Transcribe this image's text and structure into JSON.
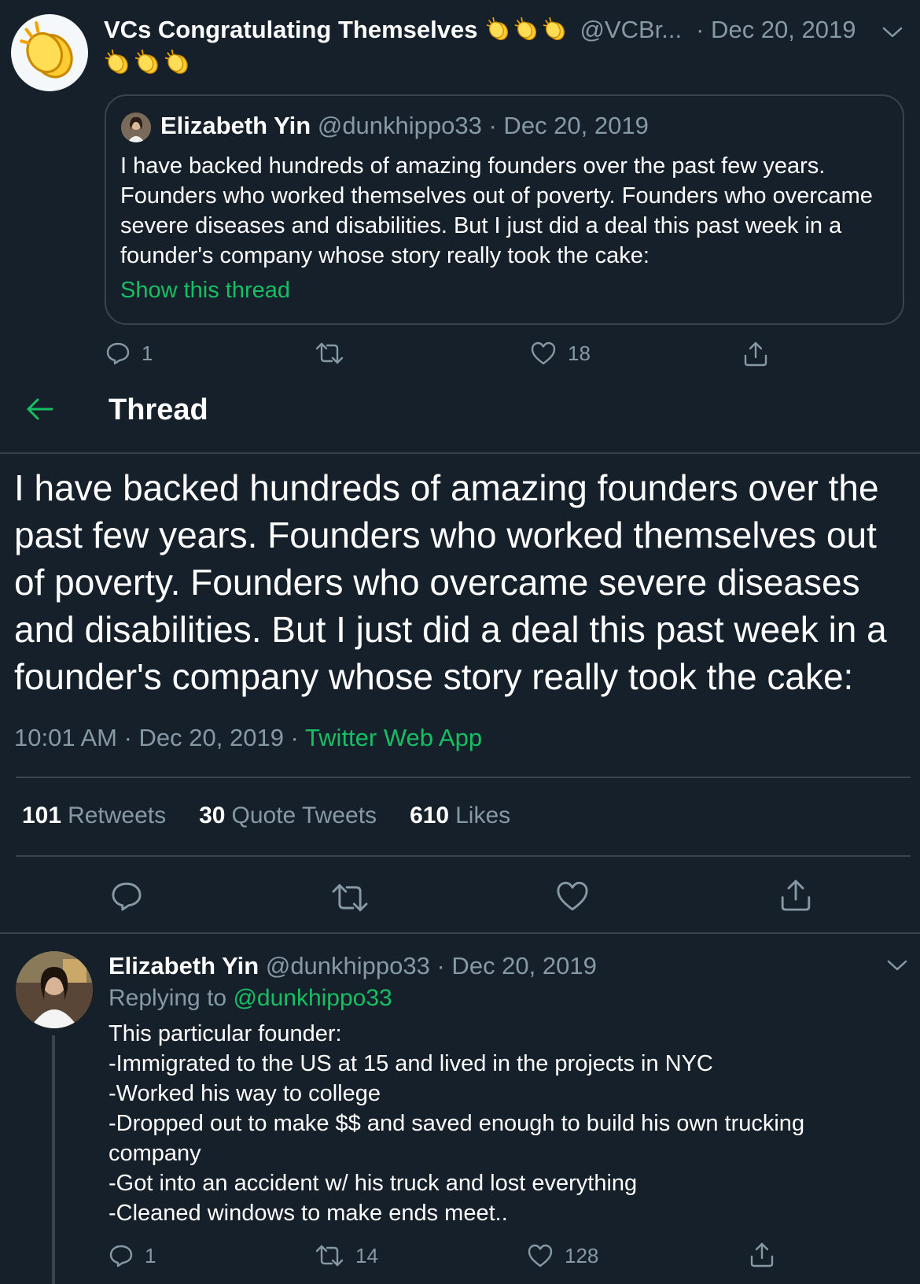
{
  "top_tweet": {
    "name": "VCs Congratulating Themselves",
    "handle": "@VCBr...",
    "date": "· Dec 20, 2019",
    "quote": {
      "name": "Elizabeth Yin",
      "handle": "@dunkhippo33",
      "date": "· Dec 20, 2019",
      "text": "I have backed hundreds of amazing founders over the past few years. Founders who worked themselves out of poverty. Founders who overcame severe diseases and disabilities. But I just did a deal this past week in a founder's company whose story really took the cake:",
      "show_thread": "Show this thread"
    },
    "actions": {
      "reply_count": "1",
      "retweet_count": "",
      "like_count": "18"
    }
  },
  "thread_header": {
    "title": "Thread"
  },
  "main_tweet": {
    "text": "I have backed hundreds of amazing founders over the past few years. Founders who worked themselves out of poverty. Founders who overcame severe diseases and disabilities. But I just did a deal this past week in a founder's company whose story really took the cake:",
    "time": "10:01 AM · Dec 20, 2019 · ",
    "source": "Twitter Web App",
    "stats": {
      "retweets_num": "101",
      "retweets_label": "Retweets",
      "quotes_num": "30",
      "quotes_label": "Quote Tweets",
      "likes_num": "610",
      "likes_label": "Likes"
    }
  },
  "reply_tweet": {
    "name": "Elizabeth Yin",
    "handle": "@dunkhippo33",
    "date": "· Dec 20, 2019",
    "replying_label": "Replying to ",
    "replying_handle": "@dunkhippo33",
    "lines": [
      "This particular founder:",
      "-Immigrated to the US at 15 and lived in the projects in NYC",
      "-Worked his way to college",
      "-Dropped out to make $$ and saved enough to build his own trucking company",
      "-Got into an accident w/ his truck and lost everything",
      "-Cleaned windows to make ends meet.."
    ],
    "actions": {
      "reply_count": "1",
      "retweet_count": "14",
      "like_count": "128"
    }
  },
  "colors": {
    "background": "#15202b",
    "accent": "#17bf63",
    "muted": "#8899a6",
    "border": "#38444d"
  }
}
